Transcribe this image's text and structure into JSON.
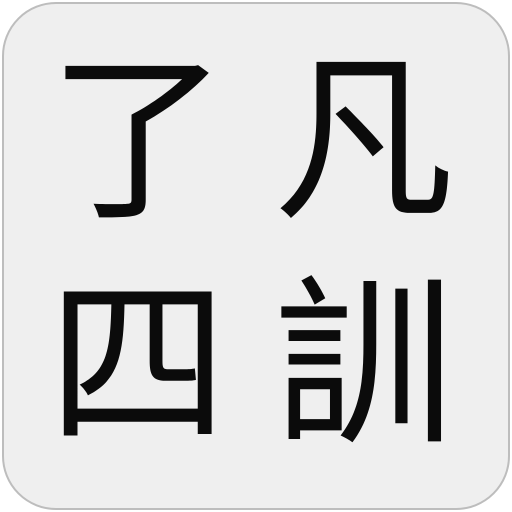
{
  "icon": {
    "characters": [
      "了",
      "凡",
      "四",
      "訓"
    ]
  }
}
